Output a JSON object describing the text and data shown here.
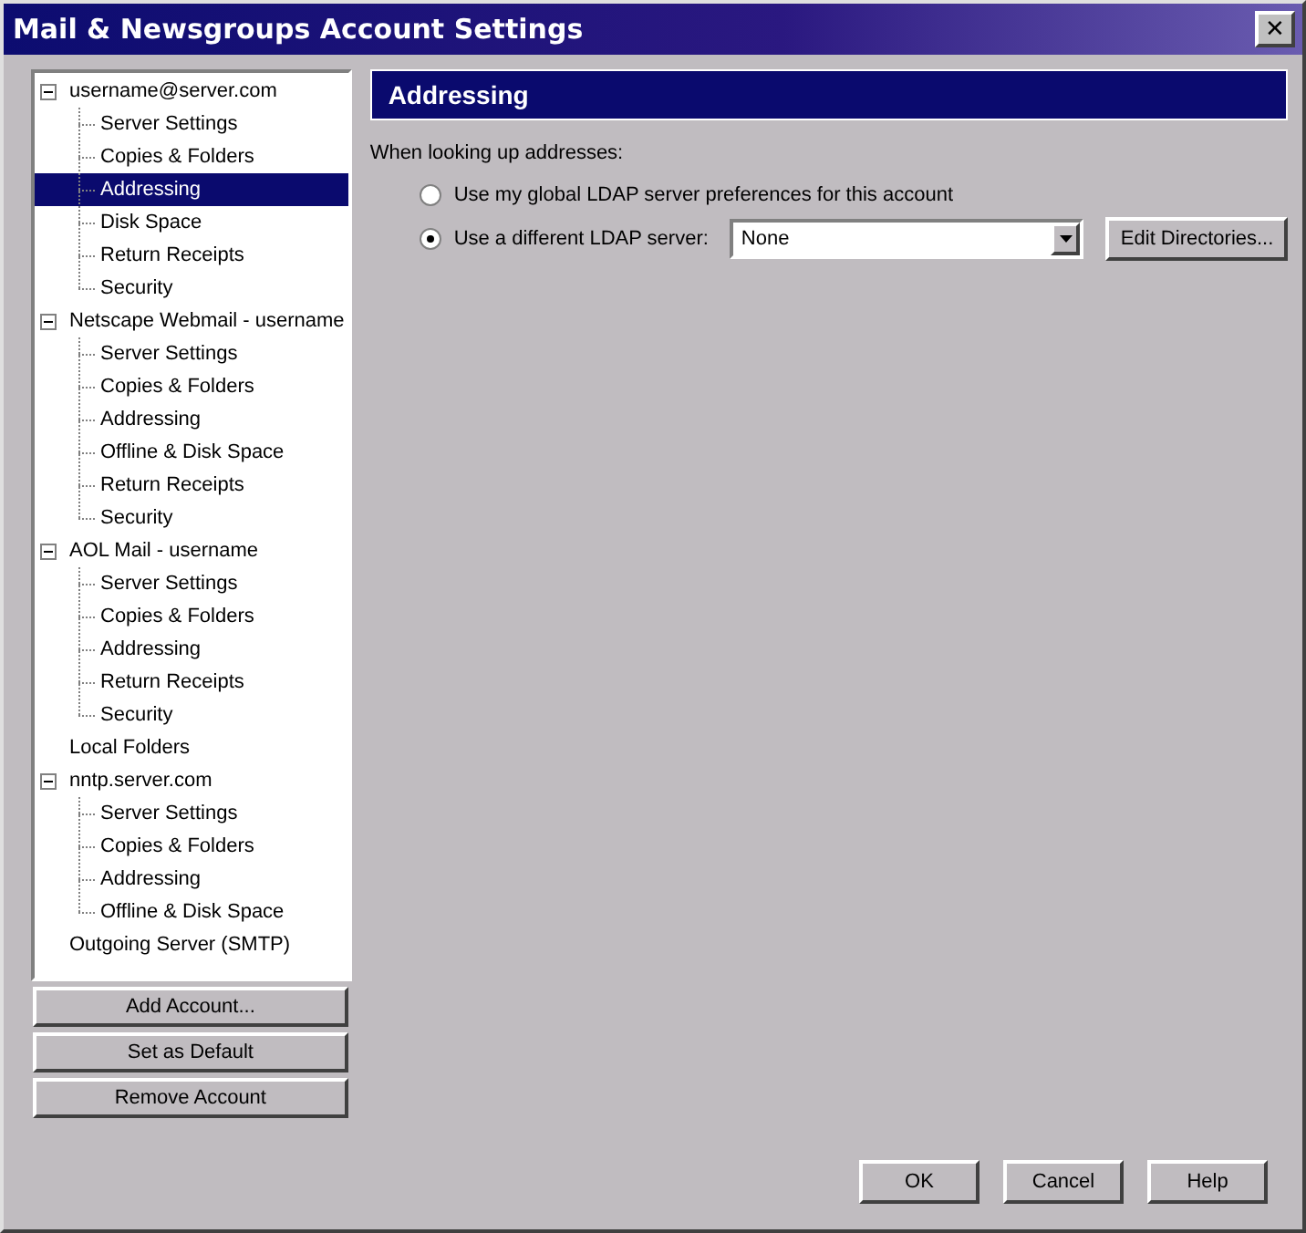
{
  "window": {
    "title": "Mail & Newsgroups Account Settings",
    "close": "✕"
  },
  "tree": [
    {
      "label": "username@server.com",
      "expanded": true,
      "selected": false,
      "children": [
        {
          "label": "Server Settings",
          "selected": false
        },
        {
          "label": "Copies & Folders",
          "selected": false
        },
        {
          "label": "Addressing",
          "selected": true
        },
        {
          "label": "Disk Space",
          "selected": false
        },
        {
          "label": "Return Receipts",
          "selected": false
        },
        {
          "label": "Security",
          "selected": false
        }
      ]
    },
    {
      "label": "Netscape Webmail - username",
      "expanded": true,
      "selected": false,
      "children": [
        {
          "label": "Server Settings",
          "selected": false
        },
        {
          "label": "Copies & Folders",
          "selected": false
        },
        {
          "label": "Addressing",
          "selected": false
        },
        {
          "label": "Offline & Disk Space",
          "selected": false
        },
        {
          "label": "Return Receipts",
          "selected": false
        },
        {
          "label": "Security",
          "selected": false
        }
      ]
    },
    {
      "label": "AOL Mail - username",
      "expanded": true,
      "selected": false,
      "children": [
        {
          "label": "Server Settings",
          "selected": false
        },
        {
          "label": "Copies & Folders",
          "selected": false
        },
        {
          "label": "Addressing",
          "selected": false
        },
        {
          "label": "Return Receipts",
          "selected": false
        },
        {
          "label": "Security",
          "selected": false
        }
      ]
    },
    {
      "label": "Local Folders",
      "selected": false
    },
    {
      "label": "nntp.server.com",
      "expanded": true,
      "selected": false,
      "children": [
        {
          "label": "Server Settings",
          "selected": false
        },
        {
          "label": "Copies & Folders",
          "selected": false
        },
        {
          "label": "Addressing",
          "selected": false
        },
        {
          "label": "Offline & Disk Space",
          "selected": false
        }
      ]
    },
    {
      "label": "Outgoing Server (SMTP)",
      "selected": false
    }
  ],
  "account_buttons": [
    "Add Account...",
    "Set as Default",
    "Remove Account"
  ],
  "panel": {
    "title": "Addressing",
    "prompt": "When looking up addresses:",
    "options": [
      {
        "label": "Use my global LDAP server preferences for this account",
        "selected": false
      },
      {
        "label": "Use a different LDAP server:",
        "selected": true
      }
    ],
    "server_select": {
      "value": "None"
    },
    "edit_button": "Edit Directories..."
  },
  "dialog_buttons": [
    "OK",
    "Cancel",
    "Help"
  ]
}
